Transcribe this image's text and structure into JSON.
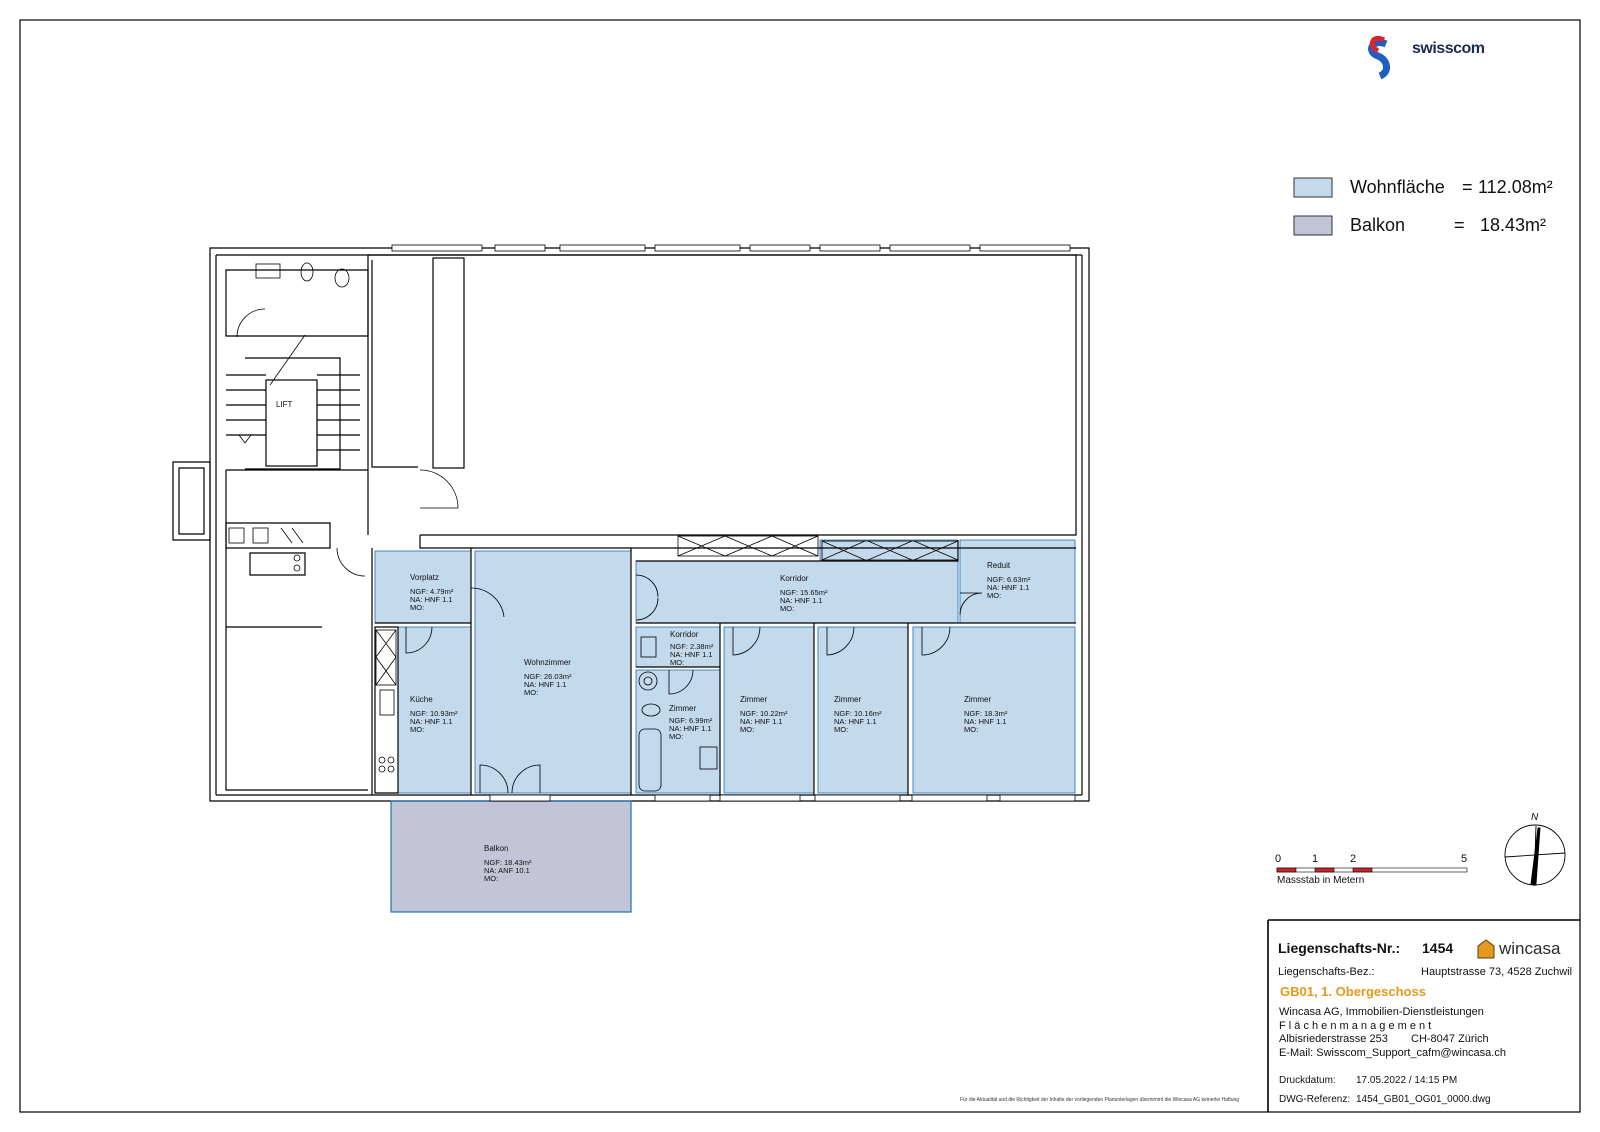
{
  "brand": {
    "logo_text": "swisscom",
    "colors": {
      "red": "#d9242f",
      "blue": "#1e5fc1"
    }
  },
  "legend": [
    {
      "label": "Wohnfläche",
      "value": "112.08m²",
      "color": "#c3d9ec"
    },
    {
      "label": "Balkon",
      "value": "18.43m²",
      "color": "#c0c6d6"
    }
  ],
  "rooms": [
    {
      "id": "vorplatz",
      "name": "Vorplatz",
      "ngf": "NGF: 4.79m²",
      "na": "NA:   HNF 1.1",
      "mo": "MO:"
    },
    {
      "id": "kueche",
      "name": "Küche",
      "ngf": "NGF: 10.93m²",
      "na": "NA:   HNF 1.1",
      "mo": "MO:"
    },
    {
      "id": "wohnzimmer",
      "name": "Wohnzimmer",
      "ngf": "NGF: 26.03m²",
      "na": "NA:   HNF 1.1",
      "mo": "MO:"
    },
    {
      "id": "korridor-main",
      "name": "Korridor",
      "ngf": "NGF: 15.65m²",
      "na": "NA:   HNF 1.1",
      "mo": "MO:"
    },
    {
      "id": "korridor-small",
      "name": "Korridor",
      "ngf": "NGF: 2.38m²",
      "na": "NA:   HNF 1.1",
      "mo": "MO:"
    },
    {
      "id": "bad",
      "name": "Zimmer",
      "ngf": "NGF: 6.99m²",
      "na": "NA:   HNF 1.1",
      "mo": "MO:"
    },
    {
      "id": "zimmer1",
      "name": "Zimmer",
      "ngf": "NGF: 10.22m²",
      "na": "NA:   HNF 1.1",
      "mo": "MO:"
    },
    {
      "id": "zimmer2",
      "name": "Zimmer",
      "ngf": "NGF: 10.16m²",
      "na": "NA:   HNF 1.1",
      "mo": "MO:"
    },
    {
      "id": "zimmer3",
      "name": "Zimmer",
      "ngf": "NGF: 18.3m²",
      "na": "NA:   HNF 1.1",
      "mo": "MO:"
    },
    {
      "id": "reduit",
      "name": "Reduit",
      "ngf": "NGF: 6.63m²",
      "na": "NA:   HNF 1.1",
      "mo": "MO:"
    },
    {
      "id": "balkon",
      "name": "Balkon",
      "ngf": "NGF: 18.43m²",
      "na": "NA:   ANF 10.1",
      "mo": "MO:"
    }
  ],
  "lift_label": "LIFT",
  "scale": {
    "ticks": [
      "0",
      "1",
      "2",
      "5"
    ],
    "caption": "Massstab in Metern"
  },
  "north_label": "N",
  "title_block": {
    "liegenschaft_label": "Liegenschafts-Nr.:",
    "liegenschaft_nr": "1454",
    "wincasa_logo": "wincasa",
    "bez_label": "Liegenschafts-Bez.:",
    "bez_value": "Hauptstrasse 73, 4528 Zuchwil",
    "floor": "GB01, 1. Obergeschoss",
    "company": "Wincasa AG,  Immobilien-Dienstleistungen",
    "department": "F l ä c h e n m a n a g e m e n t",
    "street": "Albisriederstrasse 253",
    "city": "CH-8047 Zürich",
    "email": "E-Mail: Swisscom_Support_cafm@wincasa.ch",
    "druck_label": "Druckdatum:",
    "druck_value": "17.05.2022 / 14:15 PM",
    "dwg_label": "DWG-Referenz:",
    "dwg_value": "1454_GB01_OG01_0000.dwg"
  },
  "disclaimer": "Für die Aktualität und die Richtigkeit der Inhalte der vorliegenden Planunterlagen übernimmt die Wincasa AG keinerlei Haftung"
}
